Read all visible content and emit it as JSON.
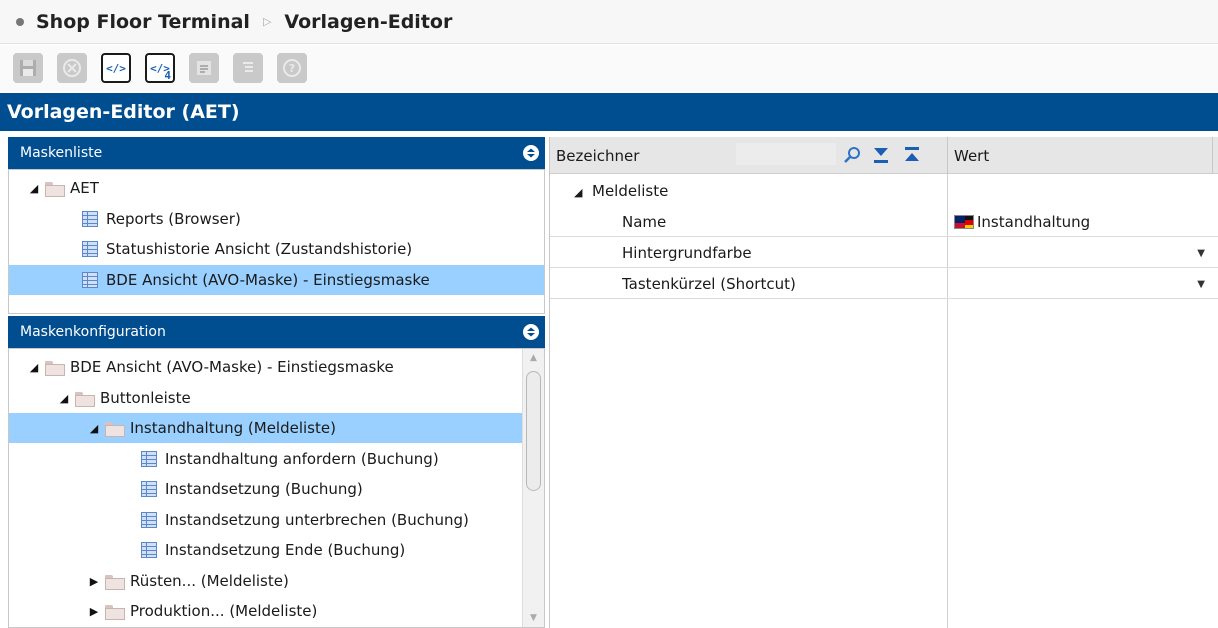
{
  "breadcrumb": {
    "app": "Shop Floor Terminal",
    "page": "Vorlagen-Editor"
  },
  "toolbar": [
    {
      "name": "save-icon",
      "enabled": false
    },
    {
      "name": "cancel-icon",
      "enabled": false
    },
    {
      "name": "code-icon",
      "enabled": true,
      "label": "</>"
    },
    {
      "name": "code-4-icon",
      "enabled": true,
      "label": "</>",
      "badge": "4"
    },
    {
      "name": "export-icon",
      "enabled": false
    },
    {
      "name": "list-icon",
      "enabled": false
    },
    {
      "name": "help-icon",
      "enabled": false
    }
  ],
  "header": {
    "title": "Vorlagen-Editor (AET)"
  },
  "maskenliste": {
    "title": "Maskenliste",
    "root": "AET",
    "items": [
      "Reports (Browser)",
      "Statushistorie Ansicht (Zustandshistorie)",
      "BDE Ansicht (AVO-Maske) - Einstiegsmaske"
    ]
  },
  "maskenkonfiguration": {
    "title": "Maskenkonfiguration",
    "items": [
      "BDE Ansicht (AVO-Maske) - Einstiegsmaske",
      "Buttonleiste",
      "Instandhaltung (Meldeliste)",
      "Instandhaltung anfordern (Buchung)",
      "Instandsetzung (Buchung)",
      "Instandsetzung unterbrechen (Buchung)",
      "Instandsetzung Ende (Buchung)",
      "Rüsten... (Meldeliste)",
      "Produktion... (Meldeliste)"
    ]
  },
  "propgrid": {
    "col_key": "Bezeichner",
    "col_value": "Wert",
    "group": "Meldeliste",
    "rows": [
      {
        "key": "Name",
        "value": "Instandhaltung"
      },
      {
        "key": "Hintergrundfarbe",
        "value": ""
      },
      {
        "key": "Tastenkürzel (Shortcut)",
        "value": ""
      }
    ]
  },
  "colors": {
    "accent": "#004e8f",
    "selection": "#99d0ff"
  }
}
